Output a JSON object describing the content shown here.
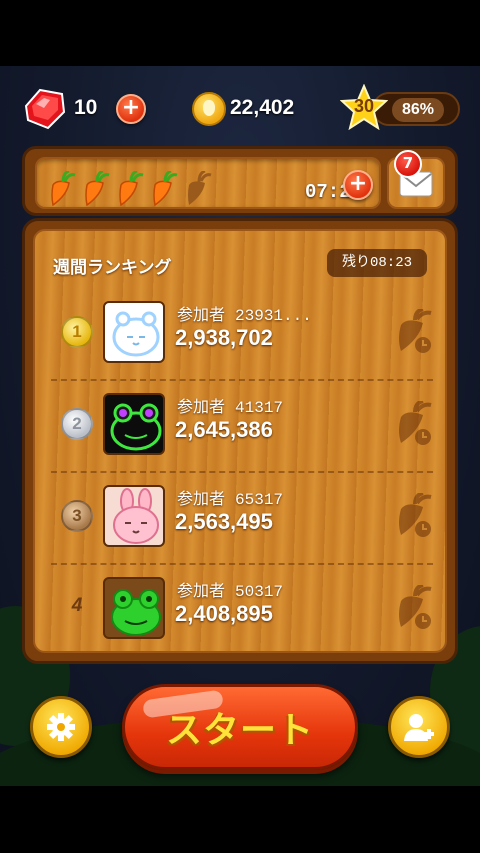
{
  "hud": {
    "ruby_count": "10",
    "coin_count": "22,402",
    "level": "30",
    "level_progress": "86%",
    "plus_symbol": "+"
  },
  "stamina": {
    "carrots_full": 4,
    "carrots_total": 5,
    "timer": "07:22",
    "mail_badge": "7"
  },
  "ranking": {
    "title": "週間ランキング",
    "remaining": "残り08:23",
    "rows": [
      {
        "rank": "1",
        "name_label": "参加者",
        "name_id": "23931...",
        "score": "2,938,702",
        "avatar": "white-cat-avatar"
      },
      {
        "rank": "2",
        "name_label": "参加者",
        "name_id": "41317",
        "score": "2,645,386",
        "avatar": "dark-frog-avatar"
      },
      {
        "rank": "3",
        "name_label": "参加者",
        "name_id": "65317",
        "score": "2,563,495",
        "avatar": "pink-rabbit-avatar"
      },
      {
        "rank": "4",
        "name_label": "参加者",
        "name_id": "50317",
        "score": "2,408,895",
        "avatar": "green-frog-avatar"
      }
    ]
  },
  "buttons": {
    "start_label": "スタート",
    "settings_icon": "gear-icon",
    "add_friend_icon": "add-friend-icon"
  },
  "colors": {
    "wood": "#d38a2e",
    "wood_frame": "#7a3e0d",
    "start_orange": "#e5350b",
    "start_text": "#ffe33a",
    "gold": "#f0a800"
  }
}
